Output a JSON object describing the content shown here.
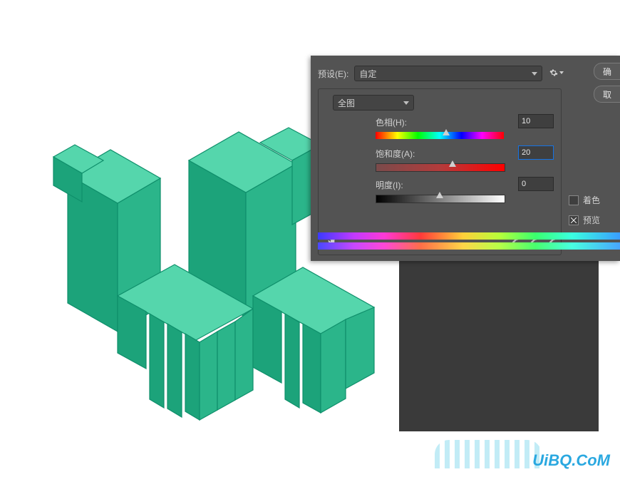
{
  "preset": {
    "label": "预设(E):",
    "value": "自定"
  },
  "range": {
    "value": "全图"
  },
  "hue": {
    "label": "色相(H):",
    "value": "10",
    "pos_pct": 55
  },
  "saturation": {
    "label": "饱和度(A):",
    "value": "20",
    "pos_pct": 60
  },
  "lightness": {
    "label": "明度(I):",
    "value": "0",
    "pos_pct": 50
  },
  "buttons": {
    "ok": "确",
    "cancel": "取"
  },
  "checkboxes": {
    "colorize": {
      "label": "着色",
      "checked": false
    },
    "preview": {
      "label": "预览",
      "checked": true
    }
  },
  "watermark": "UiBQ.CoM",
  "icons": {
    "gear": "gear-icon",
    "hand": "hand-icon",
    "eyedropper": "eyedropper-icon",
    "eyedropper_add": "eyedropper-add-icon",
    "eyedropper_sub": "eyedropper-subtract-icon"
  },
  "chart_data": {
    "type": "other",
    "description": "Isometric 3D extruded Chinese characters in teal/green (#46cfa3 tops, #1ea37a sides), arranged on white canvas.",
    "accent_color": "#46cfa3",
    "shade_color": "#1ea37a"
  }
}
